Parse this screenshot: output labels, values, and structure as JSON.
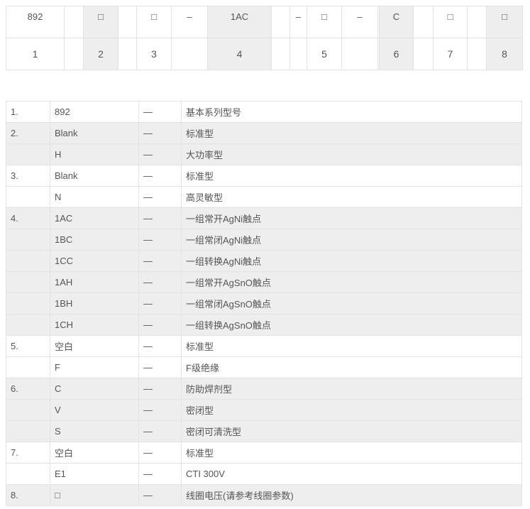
{
  "code_row": [
    "892",
    "",
    "□",
    "",
    "□",
    "–",
    "1AC",
    "",
    "–",
    "□",
    "–",
    "",
    "C",
    "",
    "□",
    "",
    "□"
  ],
  "position_row": [
    "1",
    "",
    "2",
    "",
    "3",
    "",
    "4",
    "",
    "",
    "5",
    "",
    "",
    "6",
    "",
    "7",
    "",
    "8"
  ],
  "shaded_columns": [
    2,
    6,
    12,
    16
  ],
  "spec_rows": [
    {
      "num": "1.",
      "code": "892",
      "dash": "—",
      "desc": "基本系列型号",
      "shade": false
    },
    {
      "num": "2.",
      "code": "Blank",
      "dash": "—",
      "desc": "标准型",
      "shade": true
    },
    {
      "num": "",
      "code": "H",
      "dash": "—",
      "desc": "大功率型",
      "shade": true
    },
    {
      "num": "3.",
      "code": "Blank",
      "dash": "—",
      "desc": "标准型",
      "shade": false
    },
    {
      "num": "",
      "code": "N",
      "dash": "—",
      "desc": "高灵敏型",
      "shade": false
    },
    {
      "num": "4.",
      "code": "1AC",
      "dash": "—",
      "desc": "一组常开AgNi触点",
      "shade": true
    },
    {
      "num": "",
      "code": "1BC",
      "dash": "—",
      "desc": "一组常闭AgNi触点",
      "shade": true
    },
    {
      "num": "",
      "code": "1CC",
      "dash": "—",
      "desc": "一组转换AgNi触点",
      "shade": true
    },
    {
      "num": "",
      "code": "1AH",
      "dash": "—",
      "desc": "一组常开AgSnO触点",
      "shade": true
    },
    {
      "num": "",
      "code": "1BH",
      "dash": "—",
      "desc": "一组常闭AgSnO触点",
      "shade": true
    },
    {
      "num": "",
      "code": "1CH",
      "dash": "—",
      "desc": "一组转换AgSnO触点",
      "shade": true
    },
    {
      "num": "5.",
      "code": "空白",
      "dash": "—",
      "desc": "标准型",
      "shade": false
    },
    {
      "num": "",
      "code": "F",
      "dash": "—",
      "desc": "F级绝缘",
      "shade": false
    },
    {
      "num": "6.",
      "code": "C",
      "dash": "—",
      "desc": "防助焊剂型",
      "shade": true
    },
    {
      "num": "",
      "code": "V",
      "dash": "—",
      "desc": "密闭型",
      "shade": true
    },
    {
      "num": "",
      "code": "S",
      "dash": "—",
      "desc": "密闭可清洗型",
      "shade": true
    },
    {
      "num": "7.",
      "code": "空白",
      "dash": "—",
      "desc": "标准型",
      "shade": false
    },
    {
      "num": "",
      "code": "E1",
      "dash": "—",
      "desc": "CTI 300V",
      "shade": false
    },
    {
      "num": "8.",
      "code": "□",
      "dash": "—",
      "desc": "线圈电压(请参考线圈参数)",
      "shade": true
    }
  ]
}
